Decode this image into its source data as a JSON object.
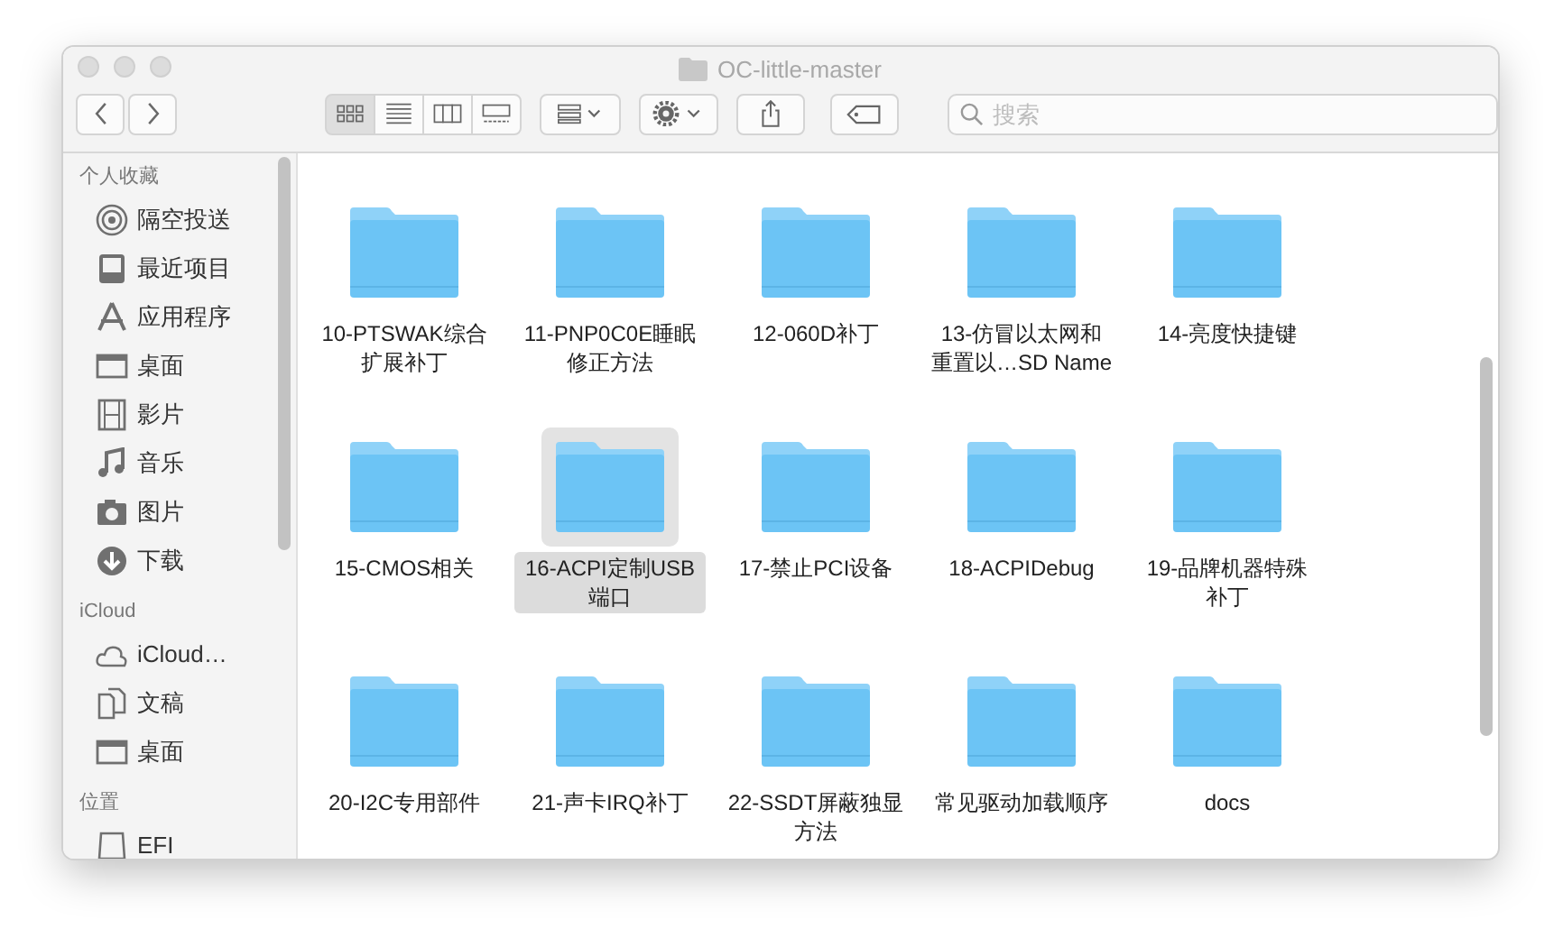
{
  "window": {
    "title": "OC-little-master"
  },
  "toolbar": {
    "view_modes": [
      {
        "kind": "icons",
        "selected": true
      },
      {
        "kind": "list",
        "selected": false
      },
      {
        "kind": "columns",
        "selected": false
      },
      {
        "kind": "gallery",
        "selected": false
      }
    ],
    "search": {
      "placeholder": "搜索"
    }
  },
  "sidebar": {
    "sections": [
      {
        "title": "个人收藏",
        "items": [
          {
            "kind": "airdrop",
            "label": "隔空投送"
          },
          {
            "kind": "recents",
            "label": "最近项目"
          },
          {
            "kind": "apps",
            "label": "应用程序"
          },
          {
            "kind": "desktop",
            "label": "桌面"
          },
          {
            "kind": "movies",
            "label": "影片"
          },
          {
            "kind": "music",
            "label": "音乐"
          },
          {
            "kind": "pictures",
            "label": "图片"
          },
          {
            "kind": "downloads",
            "label": "下载"
          }
        ]
      },
      {
        "title": "iCloud",
        "items": [
          {
            "kind": "cloud",
            "label": "iCloud…"
          },
          {
            "kind": "documents",
            "label": "文稿"
          },
          {
            "kind": "desktop",
            "label": "桌面"
          }
        ]
      },
      {
        "title": "位置",
        "items": [
          {
            "kind": "drive",
            "label": "EFI"
          }
        ]
      }
    ]
  },
  "files": [
    {
      "name": "10-PTSWAK综合扩展补丁",
      "selected": false
    },
    {
      "name": "11-PNP0C0E睡眠修正方法",
      "selected": false
    },
    {
      "name": "12-060D补丁",
      "selected": false
    },
    {
      "name": "13-仿冒以太网和重置以…SD Name",
      "selected": false
    },
    {
      "name": "14-亮度快捷键",
      "selected": false
    },
    {
      "name": "15-CMOS相关",
      "selected": false
    },
    {
      "name": "16-ACPI定制USB端口",
      "selected": true
    },
    {
      "name": "17-禁止PCI设备",
      "selected": false
    },
    {
      "name": "18-ACPIDebug",
      "selected": false
    },
    {
      "name": "19-品牌机器特殊补丁",
      "selected": false
    },
    {
      "name": "20-I2C专用部件",
      "selected": false
    },
    {
      "name": "21-声卡IRQ补丁",
      "selected": false
    },
    {
      "name": "22-SSDT屏蔽独显方法",
      "selected": false
    },
    {
      "name": "常见驱动加载顺序",
      "selected": false
    },
    {
      "name": "docs",
      "selected": false
    }
  ]
}
